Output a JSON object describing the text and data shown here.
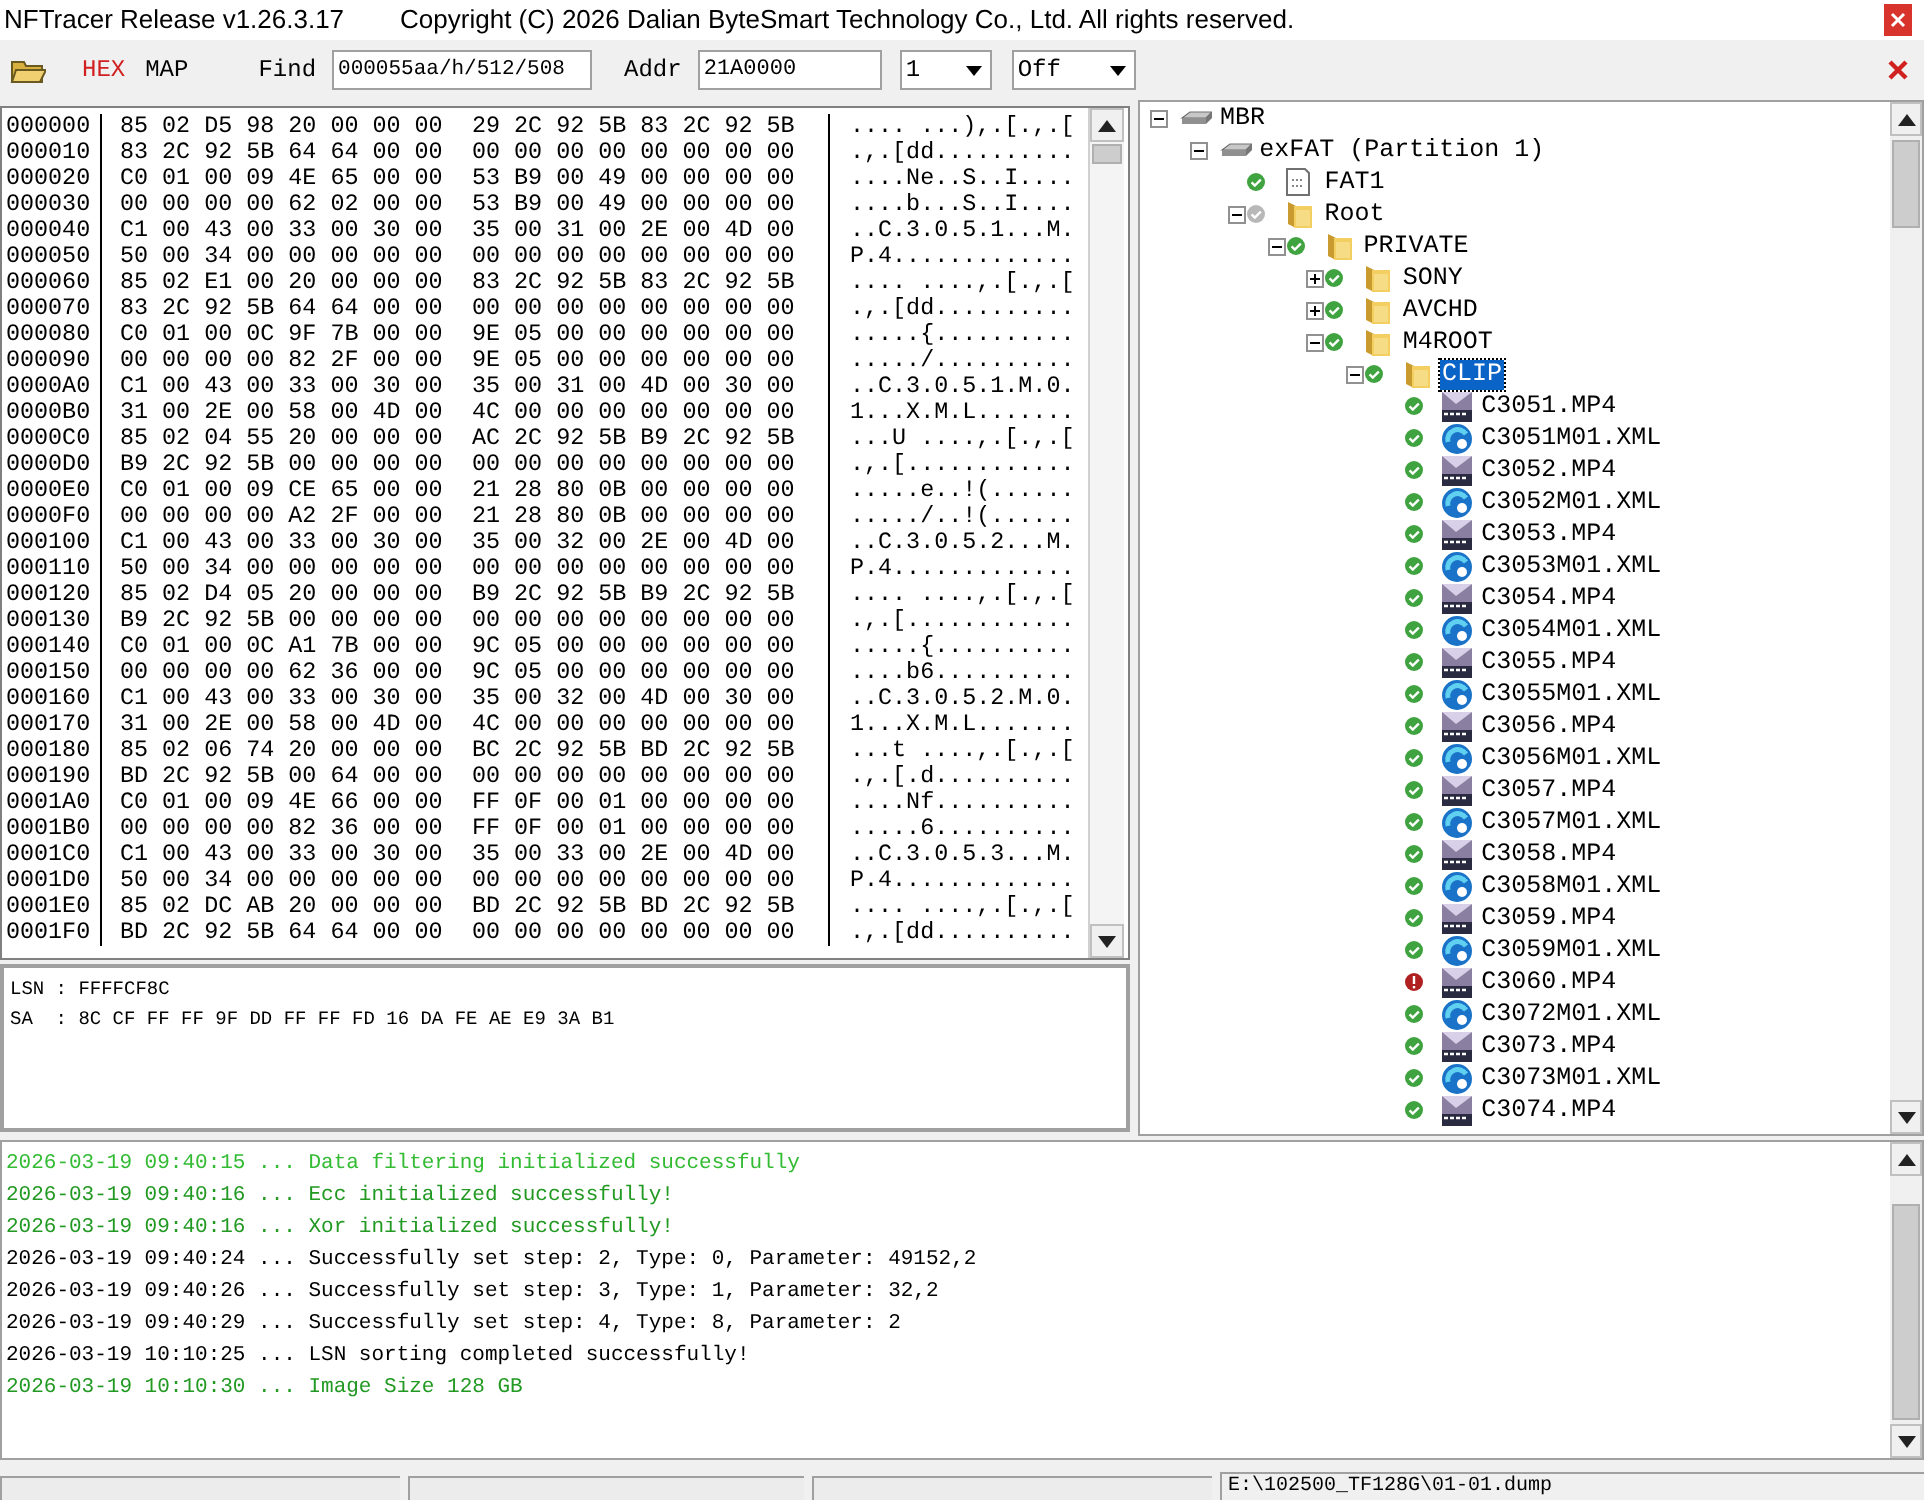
{
  "window": {
    "title": "NFTracer Release v1.26.3.17",
    "copyright": "Copyright (C) 2026 Dalian ByteSmart Technology Co., Ltd. All rights reserved."
  },
  "toolbar": {
    "tabs": [
      {
        "label": "HEX",
        "selected": true
      },
      {
        "label": "MAP",
        "selected": false
      }
    ],
    "find": {
      "label": "Find",
      "value": "000055aa/h/512/508"
    },
    "addr": {
      "label": "Addr",
      "value": "21A0000"
    },
    "dropdowns": [
      {
        "value": "1"
      },
      {
        "value": "Off"
      }
    ]
  },
  "hex_rows": [
    {
      "address": "000000",
      "bytes_1": "85 02 D5 98 20 00 00 00",
      "bytes_2": "29 2C 92 5B 83 2C 92 5B",
      "ascii": ".... ...),.[.,.["
    },
    {
      "address": "000010",
      "bytes_1": "83 2C 92 5B 64 64 00 00",
      "bytes_2": "00 00 00 00 00 00 00 00",
      "ascii": ".,.[dd.........."
    },
    {
      "address": "000020",
      "bytes_1": "C0 01 00 09 4E 65 00 00",
      "bytes_2": "53 B9 00 49 00 00 00 00",
      "ascii": "....Ne..S..I...."
    },
    {
      "address": "000030",
      "bytes_1": "00 00 00 00 62 02 00 00",
      "bytes_2": "53 B9 00 49 00 00 00 00",
      "ascii": "....b...S..I...."
    },
    {
      "address": "000040",
      "bytes_1": "C1 00 43 00 33 00 30 00",
      "bytes_2": "35 00 31 00 2E 00 4D 00",
      "ascii": "..C.3.0.5.1...M."
    },
    {
      "address": "000050",
      "bytes_1": "50 00 34 00 00 00 00 00",
      "bytes_2": "00 00 00 00 00 00 00 00",
      "ascii": "P.4............."
    },
    {
      "address": "000060",
      "bytes_1": "85 02 E1 00 20 00 00 00",
      "bytes_2": "83 2C 92 5B 83 2C 92 5B",
      "ascii": ".... ....,.[.,.["
    },
    {
      "address": "000070",
      "bytes_1": "83 2C 92 5B 64 64 00 00",
      "bytes_2": "00 00 00 00 00 00 00 00",
      "ascii": ".,.[dd.........."
    },
    {
      "address": "000080",
      "bytes_1": "C0 01 00 0C 9F 7B 00 00",
      "bytes_2": "9E 05 00 00 00 00 00 00",
      "ascii": ".....{.........."
    },
    {
      "address": "000090",
      "bytes_1": "00 00 00 00 82 2F 00 00",
      "bytes_2": "9E 05 00 00 00 00 00 00",
      "ascii": "...../.........."
    },
    {
      "address": "0000A0",
      "bytes_1": "C1 00 43 00 33 00 30 00",
      "bytes_2": "35 00 31 00 4D 00 30 00",
      "ascii": "..C.3.0.5.1.M.0."
    },
    {
      "address": "0000B0",
      "bytes_1": "31 00 2E 00 58 00 4D 00",
      "bytes_2": "4C 00 00 00 00 00 00 00",
      "ascii": "1...X.M.L......."
    },
    {
      "address": "0000C0",
      "bytes_1": "85 02 04 55 20 00 00 00",
      "bytes_2": "AC 2C 92 5B B9 2C 92 5B",
      "ascii": "...U ....,.[.,.["
    },
    {
      "address": "0000D0",
      "bytes_1": "B9 2C 92 5B 00 00 00 00",
      "bytes_2": "00 00 00 00 00 00 00 00",
      "ascii": ".,.[............"
    },
    {
      "address": "0000E0",
      "bytes_1": "C0 01 00 09 CE 65 00 00",
      "bytes_2": "21 28 80 0B 00 00 00 00",
      "ascii": ".....e..!(......"
    },
    {
      "address": "0000F0",
      "bytes_1": "00 00 00 00 A2 2F 00 00",
      "bytes_2": "21 28 80 0B 00 00 00 00",
      "ascii": "...../..!(......"
    },
    {
      "address": "000100",
      "bytes_1": "C1 00 43 00 33 00 30 00",
      "bytes_2": "35 00 32 00 2E 00 4D 00",
      "ascii": "..C.3.0.5.2...M."
    },
    {
      "address": "000110",
      "bytes_1": "50 00 34 00 00 00 00 00",
      "bytes_2": "00 00 00 00 00 00 00 00",
      "ascii": "P.4............."
    },
    {
      "address": "000120",
      "bytes_1": "85 02 D4 05 20 00 00 00",
      "bytes_2": "B9 2C 92 5B B9 2C 92 5B",
      "ascii": ".... ....,.[.,.["
    },
    {
      "address": "000130",
      "bytes_1": "B9 2C 92 5B 00 00 00 00",
      "bytes_2": "00 00 00 00 00 00 00 00",
      "ascii": ".,.[............"
    },
    {
      "address": "000140",
      "bytes_1": "C0 01 00 0C A1 7B 00 00",
      "bytes_2": "9C 05 00 00 00 00 00 00",
      "ascii": ".....{.........."
    },
    {
      "address": "000150",
      "bytes_1": "00 00 00 00 62 36 00 00",
      "bytes_2": "9C 05 00 00 00 00 00 00",
      "ascii": "....b6.........."
    },
    {
      "address": "000160",
      "bytes_1": "C1 00 43 00 33 00 30 00",
      "bytes_2": "35 00 32 00 4D 00 30 00",
      "ascii": "..C.3.0.5.2.M.0."
    },
    {
      "address": "000170",
      "bytes_1": "31 00 2E 00 58 00 4D 00",
      "bytes_2": "4C 00 00 00 00 00 00 00",
      "ascii": "1...X.M.L......."
    },
    {
      "address": "000180",
      "bytes_1": "85 02 06 74 20 00 00 00",
      "bytes_2": "BC 2C 92 5B BD 2C 92 5B",
      "ascii": "...t ....,.[.,.["
    },
    {
      "address": "000190",
      "bytes_1": "BD 2C 92 5B 00 64 00 00",
      "bytes_2": "00 00 00 00 00 00 00 00",
      "ascii": ".,.[.d.........."
    },
    {
      "address": "0001A0",
      "bytes_1": "C0 01 00 09 4E 66 00 00",
      "bytes_2": "FF 0F 00 01 00 00 00 00",
      "ascii": "....Nf.........."
    },
    {
      "address": "0001B0",
      "bytes_1": "00 00 00 00 82 36 00 00",
      "bytes_2": "FF 0F 00 01 00 00 00 00",
      "ascii": ".....6.........."
    },
    {
      "address": "0001C0",
      "bytes_1": "C1 00 43 00 33 00 30 00",
      "bytes_2": "35 00 33 00 2E 00 4D 00",
      "ascii": "..C.3.0.5.3...M."
    },
    {
      "address": "0001D0",
      "bytes_1": "50 00 34 00 00 00 00 00",
      "bytes_2": "00 00 00 00 00 00 00 00",
      "ascii": "P.4............."
    },
    {
      "address": "0001E0",
      "bytes_1": "85 02 DC AB 20 00 00 00",
      "bytes_2": "BD 2C 92 5B BD 2C 92 5B",
      "ascii": ".... ....,.[.,.["
    },
    {
      "address": "0001F0",
      "bytes_1": "BD 2C 92 5B 64 64 00 00",
      "bytes_2": "00 00 00 00 00 00 00 00",
      "ascii": ".,.[dd.........."
    }
  ],
  "sector_info": [
    "LSN : FFFFCF8C",
    "SA  : 8C CF FF FF 9F DD FF FF FD 16 DA FE AE E9 3A B1"
  ],
  "tree": [
    {
      "label": "MBR",
      "kind": "drive",
      "expanded": true,
      "selected": false,
      "children": [
        {
          "label": "exFAT (Partition 1)",
          "kind": "drive",
          "expanded": true,
          "selected": false,
          "children": [
            {
              "label": "FAT1",
              "kind": "table",
              "color": "#3fa33f",
              "error": false,
              "selected": false
            },
            {
              "label": "Root",
              "kind": "folder",
              "color": "#b8b8b8",
              "error": false,
              "expanded": true,
              "selected": false,
              "children": [
                {
                  "label": "PRIVATE",
                  "kind": "folder",
                  "color": "#3fa33f",
                  "error": false,
                  "expanded": true,
                  "selected": false,
                  "children": [
                    {
                      "label": "SONY",
                      "kind": "folder",
                      "color": "#3fa33f",
                      "error": false,
                      "expanded": false,
                      "selected": false
                    },
                    {
                      "label": "AVCHD",
                      "kind": "folder",
                      "color": "#3fa33f",
                      "error": false,
                      "expanded": false,
                      "selected": false
                    },
                    {
                      "label": "M4ROOT",
                      "kind": "folder",
                      "color": "#3fa33f",
                      "error": false,
                      "expanded": true,
                      "selected": false,
                      "children": [
                        {
                          "label": "CLIP",
                          "kind": "folder",
                          "color": "#3fa33f",
                          "error": false,
                          "expanded": true,
                          "selected": true,
                          "children": [
                            {
                              "label": "C3051.MP4",
                              "kind": "video",
                              "color": "#3fa33f",
                              "error": false,
                              "selected": false
                            },
                            {
                              "label": "C3051M01.XML",
                              "kind": "xml",
                              "color": "#3fa33f",
                              "error": false,
                              "selected": false
                            },
                            {
                              "label": "C3052.MP4",
                              "kind": "video",
                              "color": "#3fa33f",
                              "error": false,
                              "selected": false
                            },
                            {
                              "label": "C3052M01.XML",
                              "kind": "xml",
                              "color": "#3fa33f",
                              "error": false,
                              "selected": false
                            },
                            {
                              "label": "C3053.MP4",
                              "kind": "video",
                              "color": "#3fa33f",
                              "error": false,
                              "selected": false
                            },
                            {
                              "label": "C3053M01.XML",
                              "kind": "xml",
                              "color": "#3fa33f",
                              "error": false,
                              "selected": false
                            },
                            {
                              "label": "C3054.MP4",
                              "kind": "video",
                              "color": "#3fa33f",
                              "error": false,
                              "selected": false
                            },
                            {
                              "label": "C3054M01.XML",
                              "kind": "xml",
                              "color": "#3fa33f",
                              "error": false,
                              "selected": false
                            },
                            {
                              "label": "C3055.MP4",
                              "kind": "video",
                              "color": "#3fa33f",
                              "error": false,
                              "selected": false
                            },
                            {
                              "label": "C3055M01.XML",
                              "kind": "xml",
                              "color": "#3fa33f",
                              "error": false,
                              "selected": false
                            },
                            {
                              "label": "C3056.MP4",
                              "kind": "video",
                              "color": "#3fa33f",
                              "error": false,
                              "selected": false
                            },
                            {
                              "label": "C3056M01.XML",
                              "kind": "xml",
                              "color": "#3fa33f",
                              "error": false,
                              "selected": false
                            },
                            {
                              "label": "C3057.MP4",
                              "kind": "video",
                              "color": "#3fa33f",
                              "error": false,
                              "selected": false
                            },
                            {
                              "label": "C3057M01.XML",
                              "kind": "xml",
                              "color": "#3fa33f",
                              "error": false,
                              "selected": false
                            },
                            {
                              "label": "C3058.MP4",
                              "kind": "video",
                              "color": "#3fa33f",
                              "error": false,
                              "selected": false
                            },
                            {
                              "label": "C3058M01.XML",
                              "kind": "xml",
                              "color": "#3fa33f",
                              "error": false,
                              "selected": false
                            },
                            {
                              "label": "C3059.MP4",
                              "kind": "video",
                              "color": "#3fa33f",
                              "error": false,
                              "selected": false
                            },
                            {
                              "label": "C3059M01.XML",
                              "kind": "xml",
                              "color": "#3fa33f",
                              "error": false,
                              "selected": false
                            },
                            {
                              "label": "C3060.MP4",
                              "kind": "video",
                              "color": "#b02020",
                              "error": true,
                              "selected": false
                            },
                            {
                              "label": "C3072M01.XML",
                              "kind": "xml",
                              "color": "#3fa33f",
                              "error": false,
                              "selected": false
                            },
                            {
                              "label": "C3073.MP4",
                              "kind": "video",
                              "color": "#3fa33f",
                              "error": false,
                              "selected": false
                            },
                            {
                              "label": "C3073M01.XML",
                              "kind": "xml",
                              "color": "#3fa33f",
                              "error": false,
                              "selected": false
                            },
                            {
                              "label": "C3074.MP4",
                              "kind": "video",
                              "color": "#3fa33f",
                              "error": false,
                              "selected": false
                            }
                          ]
                        }
                      ]
                    }
                  ]
                }
              ]
            }
          ]
        }
      ]
    }
  ],
  "log": [
    {
      "text": "2026-03-19 09:40:15 ... Data filtering initialized successfully",
      "color": "#33bb33"
    },
    {
      "text": "2026-03-19 09:40:16 ... Ecc initialized successfully!",
      "color": "#229922"
    },
    {
      "text": "2026-03-19 09:40:16 ... Xor initialized successfully!",
      "color": "#229922"
    },
    {
      "text": "2026-03-19 09:40:24 ... Successfully set step: 2, Type: 0, Parameter: 49152,2",
      "color": "#000000"
    },
    {
      "text": "2026-03-19 09:40:26 ... Successfully set step: 3, Type: 1, Parameter: 32,2",
      "color": "#000000"
    },
    {
      "text": "2026-03-19 09:40:29 ... Successfully set step: 4, Type: 8, Parameter: 2",
      "color": "#000000"
    },
    {
      "text": "2026-03-19 10:10:25 ... LSN sorting completed successfully!",
      "color": "#000000"
    },
    {
      "text": "2026-03-19 10:10:30 ... Image Size 128 GB",
      "color": "#229922"
    }
  ],
  "status_bar": {
    "path": "E:\\102500_TF128G\\01-01.dump"
  }
}
